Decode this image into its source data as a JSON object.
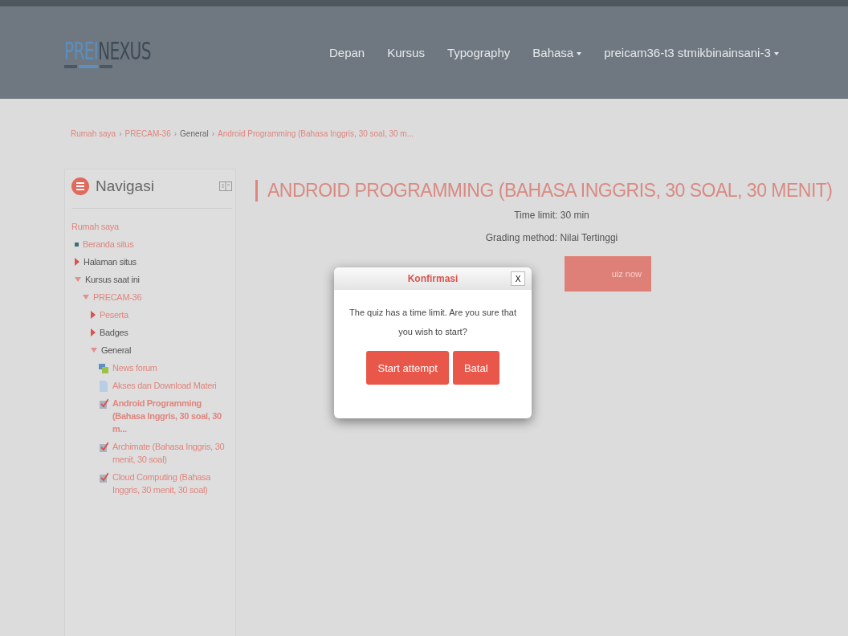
{
  "navbar": {
    "logo": {
      "main": "PREI",
      "accent": "NEXUS"
    },
    "items": [
      {
        "label": "Depan",
        "dropdown": false
      },
      {
        "label": "Kursus",
        "dropdown": false
      },
      {
        "label": "Typography",
        "dropdown": false
      },
      {
        "label": "Bahasa",
        "dropdown": true
      },
      {
        "label": "preicam36-t3 stmikbinainsani-3",
        "dropdown": true
      }
    ]
  },
  "breadcrumb": [
    {
      "kind": "link",
      "label": "Rumah saya"
    },
    {
      "kind": "separator",
      "label": "›"
    },
    {
      "kind": "link",
      "label": "PRECAM-36"
    },
    {
      "kind": "separator",
      "label": "›"
    },
    {
      "kind": "text",
      "label": "General"
    },
    {
      "kind": "separator",
      "label": "›"
    },
    {
      "kind": "link",
      "label": "Android Programming (Bahasa Inggris, 30 soal, 30 m..."
    }
  ],
  "navigation": {
    "title": "Navigasi",
    "tree": [
      {
        "label": "Rumah saya",
        "link": true,
        "children": [
          {
            "label": "Beranda situs",
            "kind": "bullet",
            "link": true
          },
          {
            "label": "Halaman situs",
            "kind": "branch",
            "expanded": false,
            "link": false
          },
          {
            "label": "Kursus saat ini",
            "kind": "branch",
            "expanded": true,
            "link": false,
            "children": [
              {
                "label": "PRECAM-36",
                "kind": "branch",
                "expanded": true,
                "link": true,
                "children": [
                  {
                    "label": "Peserta",
                    "kind": "branch",
                    "expanded": false,
                    "link": true
                  },
                  {
                    "label": "Badges",
                    "kind": "branch",
                    "expanded": false,
                    "link": false
                  },
                  {
                    "label": "General",
                    "kind": "branch",
                    "expanded": true,
                    "link": false,
                    "children": [
                      {
                        "label": "News forum",
                        "kind": "forum",
                        "link": true,
                        "selected": false
                      },
                      {
                        "label": "Akses dan Download Materi",
                        "kind": "file",
                        "link": true,
                        "selected": false
                      },
                      {
                        "label": "Android Programming (Bahasa Inggris, 30 soal, 30 m...",
                        "kind": "quiz",
                        "link": true,
                        "selected": true
                      },
                      {
                        "label": "Archimate (Bahasa Inggris, 30 menit, 30 soal)",
                        "kind": "quiz",
                        "link": true,
                        "selected": false
                      },
                      {
                        "label": "Cloud Computing (Bahasa Inggris, 30 menit, 30 soal)",
                        "kind": "quiz",
                        "link": true,
                        "selected": false
                      }
                    ]
                  }
                ]
              }
            ]
          }
        ]
      }
    ]
  },
  "quiz": {
    "title": "ANDROID PROGRAMMING (BAHASA INGGRIS, 30 SOAL, 30 MENIT)",
    "info": [
      "Time limit: 30 min",
      "Grading method: Nilai Tertinggi"
    ],
    "attempt_button": "uiz now"
  },
  "dialog": {
    "title": "Konfirmasi",
    "close": "X",
    "message": "The quiz has a time limit. Are you sure that you wish to start?",
    "buttons": [
      "Start attempt",
      "Batal"
    ]
  }
}
